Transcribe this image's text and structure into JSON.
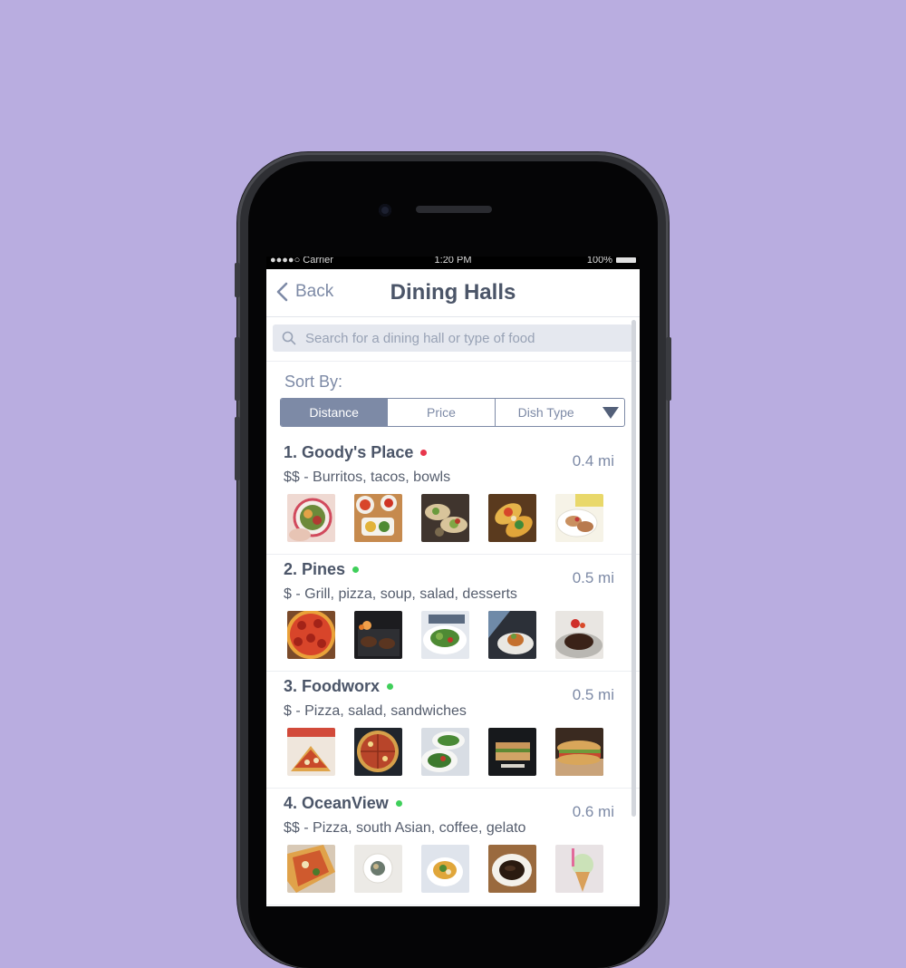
{
  "status_bar": {
    "signal": "●●●●○ Carrier",
    "time": "1:20 PM",
    "battery": "100%"
  },
  "nav": {
    "back_label": "Back",
    "title": "Dining Halls"
  },
  "search": {
    "placeholder": "Search for a dining hall or type of food"
  },
  "sort": {
    "label": "Sort By:",
    "options": [
      "Distance",
      "Price",
      "Dish Type"
    ],
    "selected": "Distance"
  },
  "status_colors": {
    "closed": "#e8364c",
    "open": "#3fcf5a"
  },
  "dining_halls": [
    {
      "name": "1. Goody's Place",
      "status": "closed",
      "distance": "0.4 mi",
      "description": "$$ - Burritos, tacos, bowls",
      "photos": [
        "bowl",
        "salsa-plates",
        "tacos",
        "loaded-tacos",
        "taco-plate"
      ]
    },
    {
      "name": "2. Pines",
      "status": "open",
      "distance": "0.5 mi",
      "description": "$ - Grill, pizza, soup, salad, desserts",
      "photos": [
        "pepperoni-pizza",
        "grill",
        "salad-plate",
        "plated-dish",
        "steak"
      ]
    },
    {
      "name": "3. Foodworx",
      "status": "open",
      "distance": "0.5 mi",
      "description": "$ - Pizza, salad, sandwiches",
      "photos": [
        "pizza-slices",
        "pizza-pan",
        "salads",
        "sandwich-dark",
        "sandwich"
      ]
    },
    {
      "name": "4. OceanView",
      "status": "open",
      "distance": "0.6 mi",
      "description": "$$ - Pizza, south Asian, coffee, gelato",
      "photos": [
        "pizza-cut",
        "bowl-white",
        "curry-bowl",
        "coffee",
        "gelato"
      ]
    }
  ]
}
